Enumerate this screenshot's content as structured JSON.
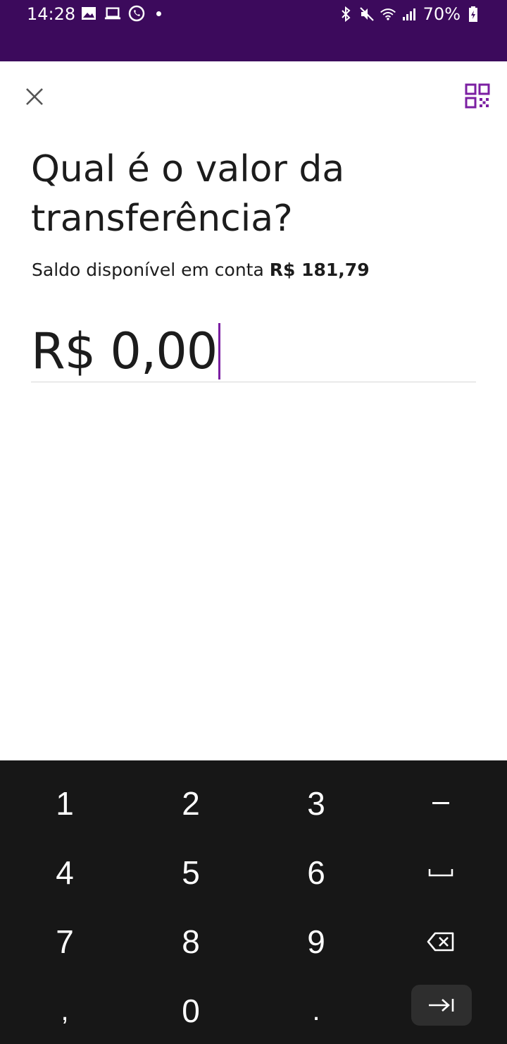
{
  "status_bar": {
    "time": "14:28",
    "battery": "70%",
    "icons_left": [
      "image-icon",
      "laptop-icon",
      "whatsapp-icon",
      "dot-icon"
    ],
    "icons_right": [
      "bluetooth-icon",
      "mute-icon",
      "wifi-icon",
      "signal-icon",
      "battery-icon"
    ],
    "background": "#3c0a5c"
  },
  "header": {
    "close_icon": "close-icon",
    "qr_icon": "qr-code-icon",
    "accent": "#7b1fa2"
  },
  "title": "Qual é o valor da transferência?",
  "balance": {
    "label": "Saldo disponível em conta",
    "amount": "R$ 181,79"
  },
  "amount_input": {
    "value": "R$ 0,00"
  },
  "keyboard": {
    "rows": [
      [
        "1",
        "2",
        "3",
        "−"
      ],
      [
        "4",
        "5",
        "6",
        "␣"
      ],
      [
        "7",
        "8",
        "9",
        "⌫"
      ],
      [
        ",",
        "0",
        ".",
        "→|"
      ]
    ]
  }
}
